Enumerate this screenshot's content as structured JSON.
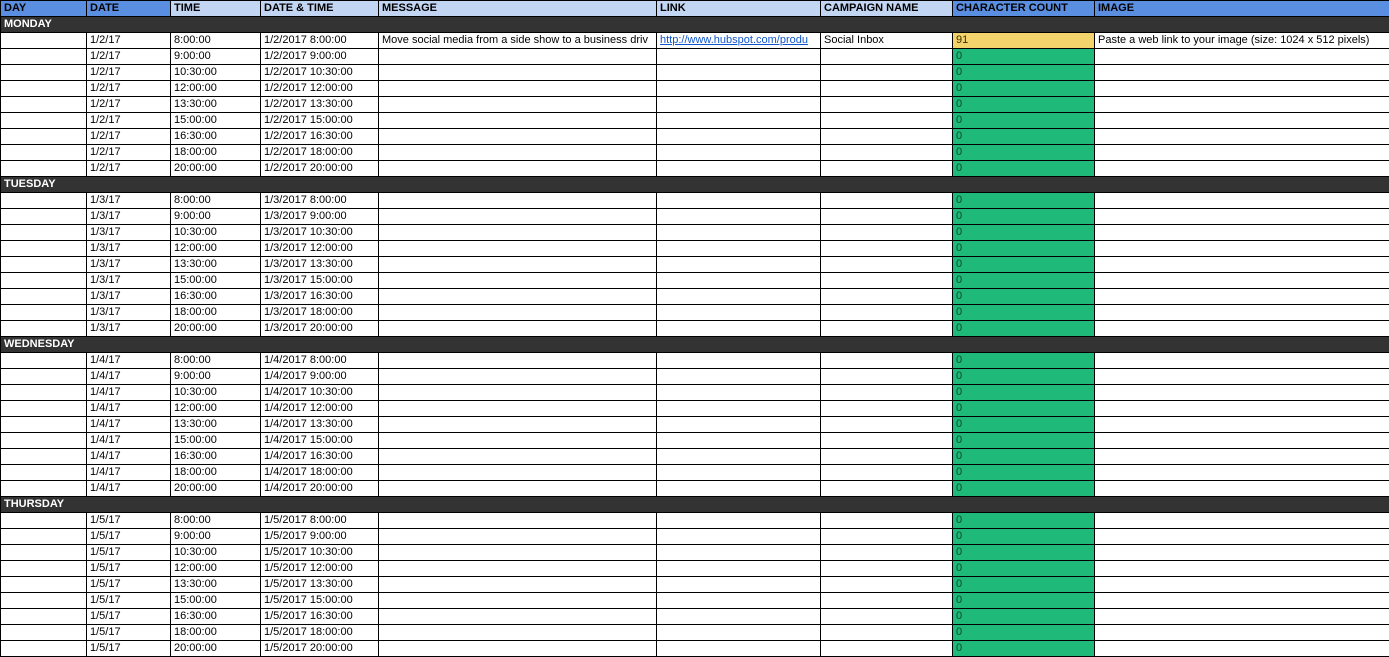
{
  "headers": {
    "day": "DAY",
    "date": "DATE",
    "time": "TIME",
    "datetime": "DATE & TIME",
    "message": "MESSAGE",
    "link": "LINK",
    "campaign": "CAMPAIGN NAME",
    "charcount": "CHARACTER COUNT",
    "image": "IMAGE"
  },
  "days": [
    {
      "label": "MONDAY",
      "rows": [
        {
          "date": "1/2/17",
          "time": "8:00:00",
          "datetime": "1/2/2017 8:00:00",
          "message": "Move social media from a side show to a business driv",
          "link": "http://www.hubspot.com/produ",
          "campaign": "Social Inbox",
          "cc": "91",
          "cc_class": "cc-yellow",
          "image": "Paste a web link to your image (size: 1024 x 512 pixels)"
        },
        {
          "date": "1/2/17",
          "time": "9:00:00",
          "datetime": "1/2/2017 9:00:00",
          "message": "",
          "link": "",
          "campaign": "",
          "cc": "0",
          "cc_class": "cc-green",
          "image": ""
        },
        {
          "date": "1/2/17",
          "time": "10:30:00",
          "datetime": "1/2/2017 10:30:00",
          "message": "",
          "link": "",
          "campaign": "",
          "cc": "0",
          "cc_class": "cc-green",
          "image": ""
        },
        {
          "date": "1/2/17",
          "time": "12:00:00",
          "datetime": "1/2/2017 12:00:00",
          "message": "",
          "link": "",
          "campaign": "",
          "cc": "0",
          "cc_class": "cc-green",
          "image": ""
        },
        {
          "date": "1/2/17",
          "time": "13:30:00",
          "datetime": "1/2/2017 13:30:00",
          "message": "",
          "link": "",
          "campaign": "",
          "cc": "0",
          "cc_class": "cc-green",
          "image": ""
        },
        {
          "date": "1/2/17",
          "time": "15:00:00",
          "datetime": "1/2/2017 15:00:00",
          "message": "",
          "link": "",
          "campaign": "",
          "cc": "0",
          "cc_class": "cc-green",
          "image": ""
        },
        {
          "date": "1/2/17",
          "time": "16:30:00",
          "datetime": "1/2/2017 16:30:00",
          "message": "",
          "link": "",
          "campaign": "",
          "cc": "0",
          "cc_class": "cc-green",
          "image": ""
        },
        {
          "date": "1/2/17",
          "time": "18:00:00",
          "datetime": "1/2/2017 18:00:00",
          "message": "",
          "link": "",
          "campaign": "",
          "cc": "0",
          "cc_class": "cc-green",
          "image": ""
        },
        {
          "date": "1/2/17",
          "time": "20:00:00",
          "datetime": "1/2/2017 20:00:00",
          "message": "",
          "link": "",
          "campaign": "",
          "cc": "0",
          "cc_class": "cc-green",
          "image": ""
        }
      ]
    },
    {
      "label": "TUESDAY",
      "rows": [
        {
          "date": "1/3/17",
          "time": "8:00:00",
          "datetime": "1/3/2017 8:00:00",
          "message": "",
          "link": "",
          "campaign": "",
          "cc": "0",
          "cc_class": "cc-green",
          "image": ""
        },
        {
          "date": "1/3/17",
          "time": "9:00:00",
          "datetime": "1/3/2017 9:00:00",
          "message": "",
          "link": "",
          "campaign": "",
          "cc": "0",
          "cc_class": "cc-green",
          "image": ""
        },
        {
          "date": "1/3/17",
          "time": "10:30:00",
          "datetime": "1/3/2017 10:30:00",
          "message": "",
          "link": "",
          "campaign": "",
          "cc": "0",
          "cc_class": "cc-green",
          "image": ""
        },
        {
          "date": "1/3/17",
          "time": "12:00:00",
          "datetime": "1/3/2017 12:00:00",
          "message": "",
          "link": "",
          "campaign": "",
          "cc": "0",
          "cc_class": "cc-green",
          "image": ""
        },
        {
          "date": "1/3/17",
          "time": "13:30:00",
          "datetime": "1/3/2017 13:30:00",
          "message": "",
          "link": "",
          "campaign": "",
          "cc": "0",
          "cc_class": "cc-green",
          "image": ""
        },
        {
          "date": "1/3/17",
          "time": "15:00:00",
          "datetime": "1/3/2017 15:00:00",
          "message": "",
          "link": "",
          "campaign": "",
          "cc": "0",
          "cc_class": "cc-green",
          "image": ""
        },
        {
          "date": "1/3/17",
          "time": "16:30:00",
          "datetime": "1/3/2017 16:30:00",
          "message": "",
          "link": "",
          "campaign": "",
          "cc": "0",
          "cc_class": "cc-green",
          "image": ""
        },
        {
          "date": "1/3/17",
          "time": "18:00:00",
          "datetime": "1/3/2017 18:00:00",
          "message": "",
          "link": "",
          "campaign": "",
          "cc": "0",
          "cc_class": "cc-green",
          "image": ""
        },
        {
          "date": "1/3/17",
          "time": "20:00:00",
          "datetime": "1/3/2017 20:00:00",
          "message": "",
          "link": "",
          "campaign": "",
          "cc": "0",
          "cc_class": "cc-green",
          "image": ""
        }
      ]
    },
    {
      "label": "WEDNESDAY",
      "rows": [
        {
          "date": "1/4/17",
          "time": "8:00:00",
          "datetime": "1/4/2017 8:00:00",
          "message": "",
          "link": "",
          "campaign": "",
          "cc": "0",
          "cc_class": "cc-green",
          "image": ""
        },
        {
          "date": "1/4/17",
          "time": "9:00:00",
          "datetime": "1/4/2017 9:00:00",
          "message": "",
          "link": "",
          "campaign": "",
          "cc": "0",
          "cc_class": "cc-green",
          "image": ""
        },
        {
          "date": "1/4/17",
          "time": "10:30:00",
          "datetime": "1/4/2017 10:30:00",
          "message": "",
          "link": "",
          "campaign": "",
          "cc": "0",
          "cc_class": "cc-green",
          "image": ""
        },
        {
          "date": "1/4/17",
          "time": "12:00:00",
          "datetime": "1/4/2017 12:00:00",
          "message": "",
          "link": "",
          "campaign": "",
          "cc": "0",
          "cc_class": "cc-green",
          "image": ""
        },
        {
          "date": "1/4/17",
          "time": "13:30:00",
          "datetime": "1/4/2017 13:30:00",
          "message": "",
          "link": "",
          "campaign": "",
          "cc": "0",
          "cc_class": "cc-green",
          "image": ""
        },
        {
          "date": "1/4/17",
          "time": "15:00:00",
          "datetime": "1/4/2017 15:00:00",
          "message": "",
          "link": "",
          "campaign": "",
          "cc": "0",
          "cc_class": "cc-green",
          "image": ""
        },
        {
          "date": "1/4/17",
          "time": "16:30:00",
          "datetime": "1/4/2017 16:30:00",
          "message": "",
          "link": "",
          "campaign": "",
          "cc": "0",
          "cc_class": "cc-green",
          "image": ""
        },
        {
          "date": "1/4/17",
          "time": "18:00:00",
          "datetime": "1/4/2017 18:00:00",
          "message": "",
          "link": "",
          "campaign": "",
          "cc": "0",
          "cc_class": "cc-green",
          "image": ""
        },
        {
          "date": "1/4/17",
          "time": "20:00:00",
          "datetime": "1/4/2017 20:00:00",
          "message": "",
          "link": "",
          "campaign": "",
          "cc": "0",
          "cc_class": "cc-green",
          "image": ""
        }
      ]
    },
    {
      "label": "THURSDAY",
      "rows": [
        {
          "date": "1/5/17",
          "time": "8:00:00",
          "datetime": "1/5/2017 8:00:00",
          "message": "",
          "link": "",
          "campaign": "",
          "cc": "0",
          "cc_class": "cc-green",
          "image": ""
        },
        {
          "date": "1/5/17",
          "time": "9:00:00",
          "datetime": "1/5/2017 9:00:00",
          "message": "",
          "link": "",
          "campaign": "",
          "cc": "0",
          "cc_class": "cc-green",
          "image": ""
        },
        {
          "date": "1/5/17",
          "time": "10:30:00",
          "datetime": "1/5/2017 10:30:00",
          "message": "",
          "link": "",
          "campaign": "",
          "cc": "0",
          "cc_class": "cc-green",
          "image": ""
        },
        {
          "date": "1/5/17",
          "time": "12:00:00",
          "datetime": "1/5/2017 12:00:00",
          "message": "",
          "link": "",
          "campaign": "",
          "cc": "0",
          "cc_class": "cc-green",
          "image": ""
        },
        {
          "date": "1/5/17",
          "time": "13:30:00",
          "datetime": "1/5/2017 13:30:00",
          "message": "",
          "link": "",
          "campaign": "",
          "cc": "0",
          "cc_class": "cc-green",
          "image": ""
        },
        {
          "date": "1/5/17",
          "time": "15:00:00",
          "datetime": "1/5/2017 15:00:00",
          "message": "",
          "link": "",
          "campaign": "",
          "cc": "0",
          "cc_class": "cc-green",
          "image": ""
        },
        {
          "date": "1/5/17",
          "time": "16:30:00",
          "datetime": "1/5/2017 16:30:00",
          "message": "",
          "link": "",
          "campaign": "",
          "cc": "0",
          "cc_class": "cc-green",
          "image": ""
        },
        {
          "date": "1/5/17",
          "time": "18:00:00",
          "datetime": "1/5/2017 18:00:00",
          "message": "",
          "link": "",
          "campaign": "",
          "cc": "0",
          "cc_class": "cc-green",
          "image": ""
        },
        {
          "date": "1/5/17",
          "time": "20:00:00",
          "datetime": "1/5/2017 20:00:00",
          "message": "",
          "link": "",
          "campaign": "",
          "cc": "0",
          "cc_class": "cc-green",
          "image": ""
        }
      ]
    }
  ]
}
